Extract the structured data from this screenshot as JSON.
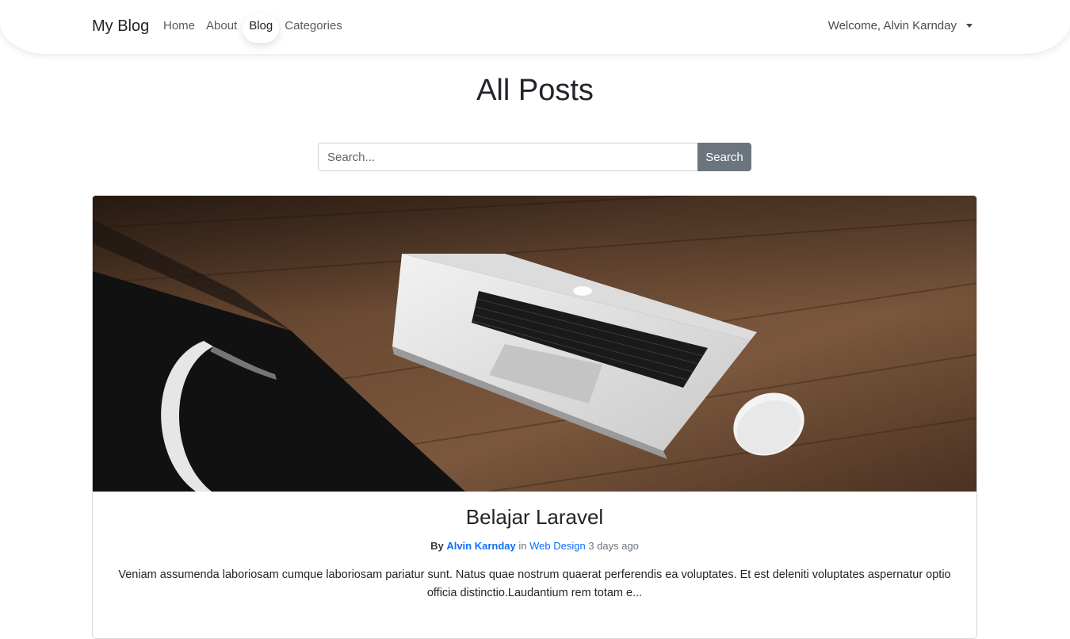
{
  "navbar": {
    "brand": "My Blog",
    "links": [
      {
        "label": "Home"
      },
      {
        "label": "About"
      },
      {
        "label": "Blog"
      },
      {
        "label": "Categories"
      }
    ],
    "user_menu": "Welcome, Alvin Karnday"
  },
  "page": {
    "title": "All Posts"
  },
  "search": {
    "placeholder": "Search...",
    "value": "",
    "button_label": "Search"
  },
  "post": {
    "title": "Belajar Laravel",
    "by_label": "By",
    "author": "Alvin Karnday",
    "in_label": "in",
    "category": "Web Design",
    "time_ago": "3 days ago",
    "excerpt": "Veniam assumenda laboriosam cumque laboriosam pariatur sunt. Natus quae nostrum quaerat perferendis ea voluptates. Et est deleniti voluptates aspernatur optio officia distinctio.Laudantium rem totam e..."
  },
  "colors": {
    "link": "#0d6efd",
    "search_button": "#6c757d"
  }
}
